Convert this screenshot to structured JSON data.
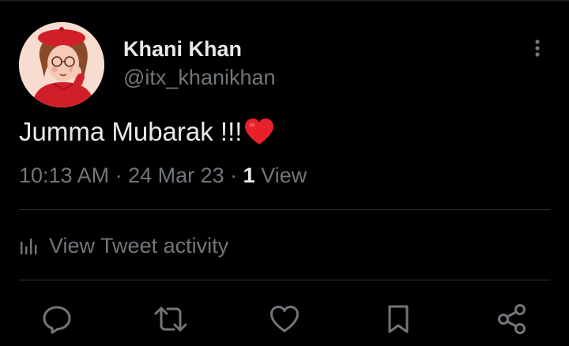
{
  "tweet": {
    "author_name": "Khani Khan",
    "author_handle": "@itx_khanikhan",
    "text": "Jumma Mubarak !!!",
    "emoji": "heart",
    "time": "10:13 AM",
    "separator": " · ",
    "date": "24 Mar 23",
    "view_count": "1",
    "view_label": " View"
  },
  "activity": {
    "label": "View Tweet activity",
    "icon": "bar-chart-icon"
  },
  "actions": {
    "items": [
      "reply-icon",
      "retweet-icon",
      "like-icon",
      "bookmark-icon",
      "share-icon"
    ]
  },
  "colors": {
    "background": "#000000",
    "primary_text": "#e7e9ea",
    "secondary_text": "#71767b",
    "divider": "#2f3336",
    "heart": "#e8202a"
  }
}
